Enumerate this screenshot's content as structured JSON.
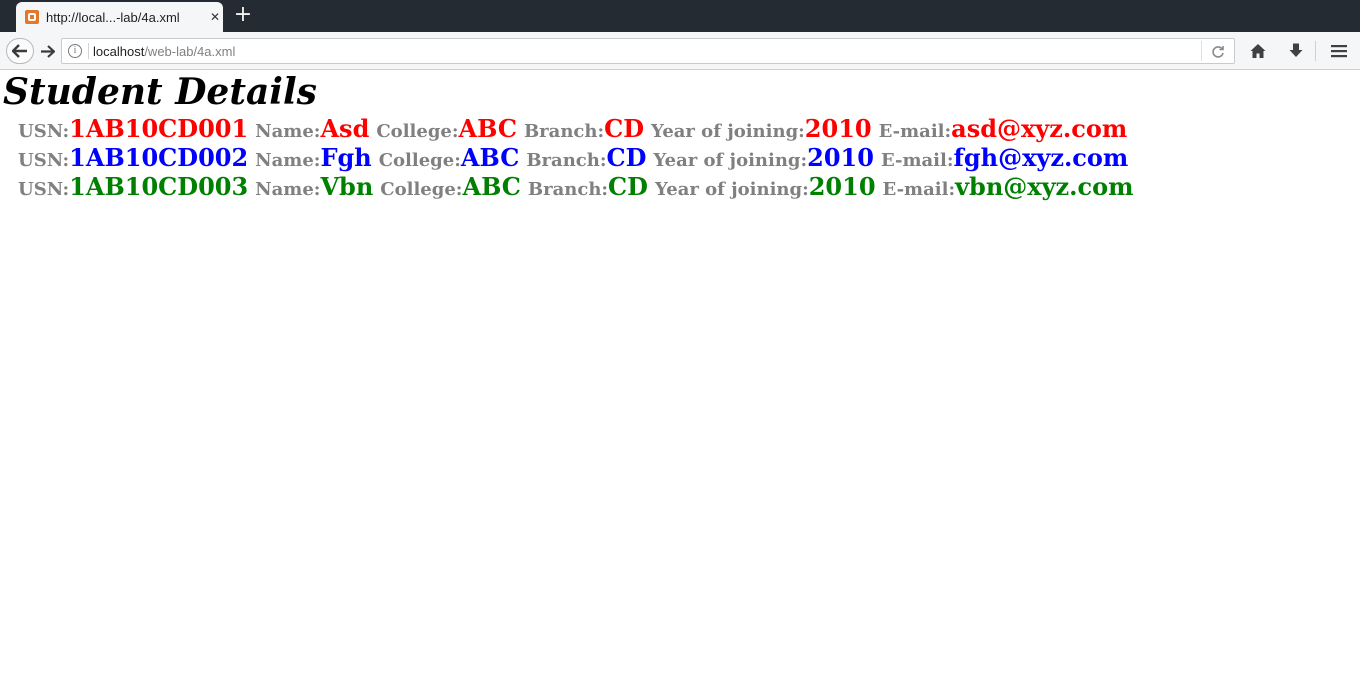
{
  "browser": {
    "tab": {
      "title": "http://local...-lab/4a.xml",
      "close_glyph": "✕"
    },
    "new_tab_glyph": "+",
    "url": {
      "host": "localhost",
      "path": "/web-lab/4a.xml",
      "info_glyph": "i"
    }
  },
  "icons": {
    "back": "back-arrow-icon",
    "forward": "forward-arrow-icon",
    "reload": "reload-icon",
    "home": "home-icon",
    "download": "download-arrow-icon",
    "menu": "hamburger-menu-icon",
    "favicon": "xml-file-icon"
  },
  "page": {
    "title": "Student Details",
    "labels": {
      "usn": "USN:",
      "name": "Name:",
      "college": "College:",
      "branch": "Branch:",
      "year": "Year of joining:",
      "email": "E-mail:"
    },
    "students": [
      {
        "usn": "1AB10CD001",
        "name": "Asd",
        "college": "ABC",
        "branch": "CD",
        "year": "2010",
        "email": "asd@xyz.com",
        "color": "#ff0000"
      },
      {
        "usn": "1AB10CD002",
        "name": "Fgh",
        "college": "ABC",
        "branch": "CD",
        "year": "2010",
        "email": "fgh@xyz.com",
        "color": "#0000ff"
      },
      {
        "usn": "1AB10CD003",
        "name": "Vbn",
        "college": "ABC",
        "branch": "CD",
        "year": "2010",
        "email": "vbn@xyz.com",
        "color": "#008000"
      }
    ],
    "label_color": "#808080"
  }
}
